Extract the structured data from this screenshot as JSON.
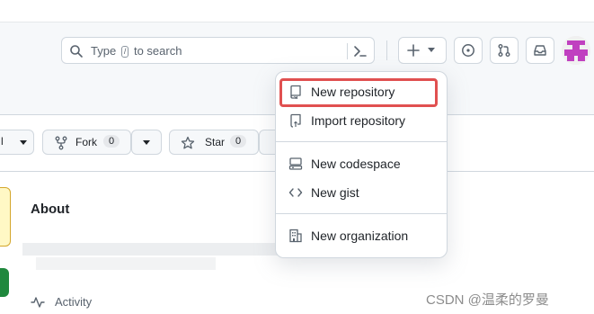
{
  "search": {
    "placeholder_before": "Type",
    "shortcut_key": "/",
    "placeholder_after": "to search"
  },
  "header_icons": [
    "search-icon",
    "command-palette-icon",
    "plus-icon",
    "chevron-down-icon",
    "issue-icon",
    "pull-request-icon",
    "inbox-icon",
    "avatar"
  ],
  "repo_actions": {
    "fork_label": "Fork",
    "fork_count": "0",
    "star_label": "Star",
    "star_count": "0"
  },
  "about": {
    "title": "About"
  },
  "activity": {
    "label": "Activity"
  },
  "menu": {
    "items": [
      {
        "label": "New repository",
        "icon": "repo-icon",
        "highlighted": true
      },
      {
        "label": "Import repository",
        "icon": "repo-push-icon"
      },
      {
        "label": "New codespace",
        "icon": "codespace-icon"
      },
      {
        "label": "New gist",
        "icon": "code-icon"
      },
      {
        "label": "New organization",
        "icon": "organization-icon"
      }
    ]
  },
  "watermark": "CSDN @温柔的罗曼",
  "colors": {
    "highlight": "#e05050",
    "header_bg": "#f6f8fa",
    "border": "#d0d7de",
    "avatar": "#c040c0"
  }
}
